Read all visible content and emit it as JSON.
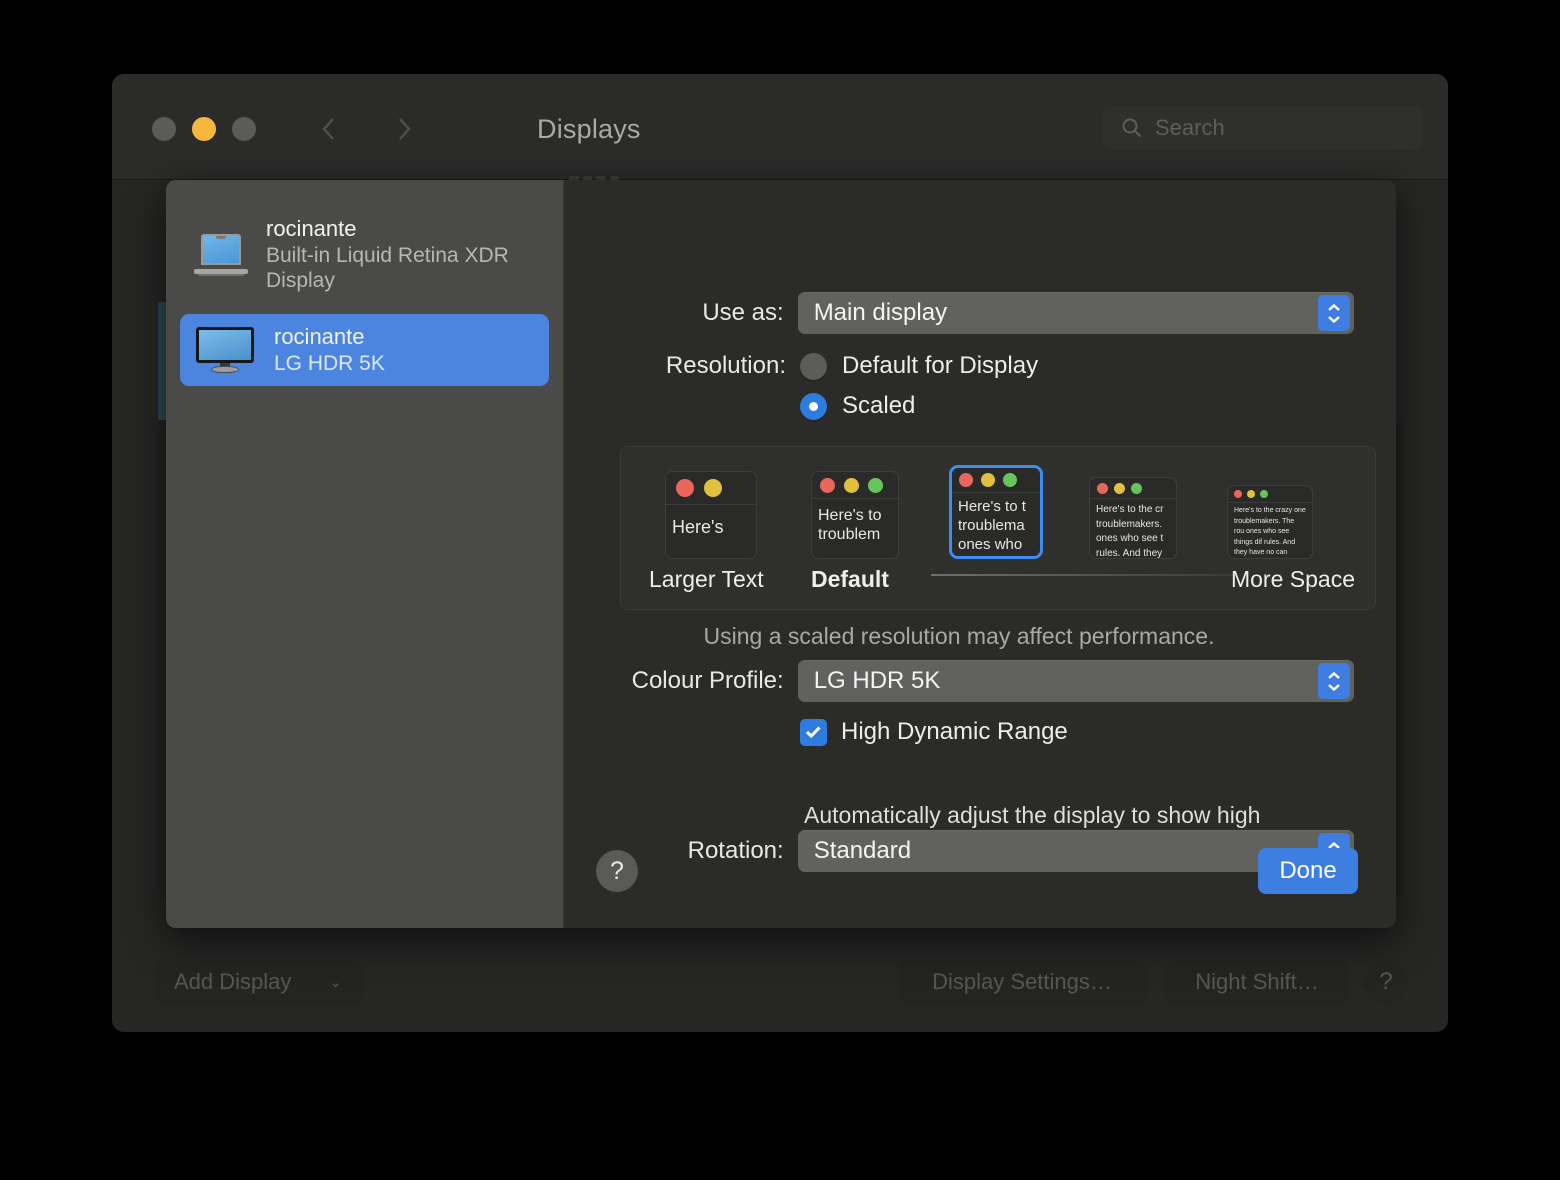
{
  "window": {
    "title": "Displays",
    "traffic_lights": [
      "close",
      "minimize",
      "zoom"
    ],
    "search": {
      "placeholder": "Search",
      "value": ""
    }
  },
  "sidebar": {
    "displays": [
      {
        "name": "rocinante",
        "subtitle": "Built-in Liquid Retina XDR Display",
        "icon": "laptop-icon",
        "selected": false
      },
      {
        "name": "rocinante",
        "subtitle": "LG HDR 5K",
        "icon": "monitor-icon",
        "selected": true
      }
    ]
  },
  "form": {
    "use_as_label": "Use as:",
    "use_as_value": "Main display",
    "resolution_label": "Resolution:",
    "resolution_options": [
      {
        "label": "Default for Display",
        "selected": false
      },
      {
        "label": "Scaled",
        "selected": true
      }
    ],
    "scale_caption_left": "Larger Text",
    "scale_caption_default": "Default",
    "scale_caption_right": "More Space",
    "scale_note": "Using a scaled resolution may affect performance.",
    "scale_thumbnails": [
      {
        "id": "larger-text",
        "text": "Here's",
        "selected": false,
        "dots": 2,
        "font_size": 18
      },
      {
        "id": "step-2",
        "text": "Here's to troublem",
        "selected": false,
        "dots": 3,
        "font_size": 16
      },
      {
        "id": "selected-scale",
        "text": "Here's to t troublema ones who",
        "selected": true,
        "dots": 3,
        "font_size": 15
      },
      {
        "id": "step-4",
        "text": "Here's to the cr troublemakers. ones who see t rules. And they",
        "selected": false,
        "dots": 3,
        "font_size": 10
      },
      {
        "id": "more-space",
        "text": "Here's to the crazy one troublemakers. The rou ones who see things dif rules. And they have no can quote them, disagr them. About the only th Because they change th",
        "selected": false,
        "dots": 3,
        "font_size": 7
      }
    ],
    "colour_profile_label": "Colour Profile:",
    "colour_profile_value": "LG HDR 5K",
    "hdr_label": "High Dynamic Range",
    "hdr_checked": true,
    "hdr_description": "Automatically adjust the display to show high dynamic range content.",
    "rotation_label": "Rotation:",
    "rotation_value": "Standard"
  },
  "sheet_footer": {
    "help_label": "?",
    "done_label": "Done"
  },
  "background_buttons": {
    "add_display": "Add Display",
    "add_display_chevron": "⌄",
    "display_settings": "Display Settings…",
    "night_shift": "Night Shift…",
    "help": "?"
  },
  "colors": {
    "accent_blue": "#3d7fe0",
    "selection_blue": "#4b85df",
    "minimize_yellow": "#f5b73d",
    "window_bg": "#262625",
    "sheet_sidebar": "#4a4a49",
    "sheet_main": "#2b2b2a"
  }
}
